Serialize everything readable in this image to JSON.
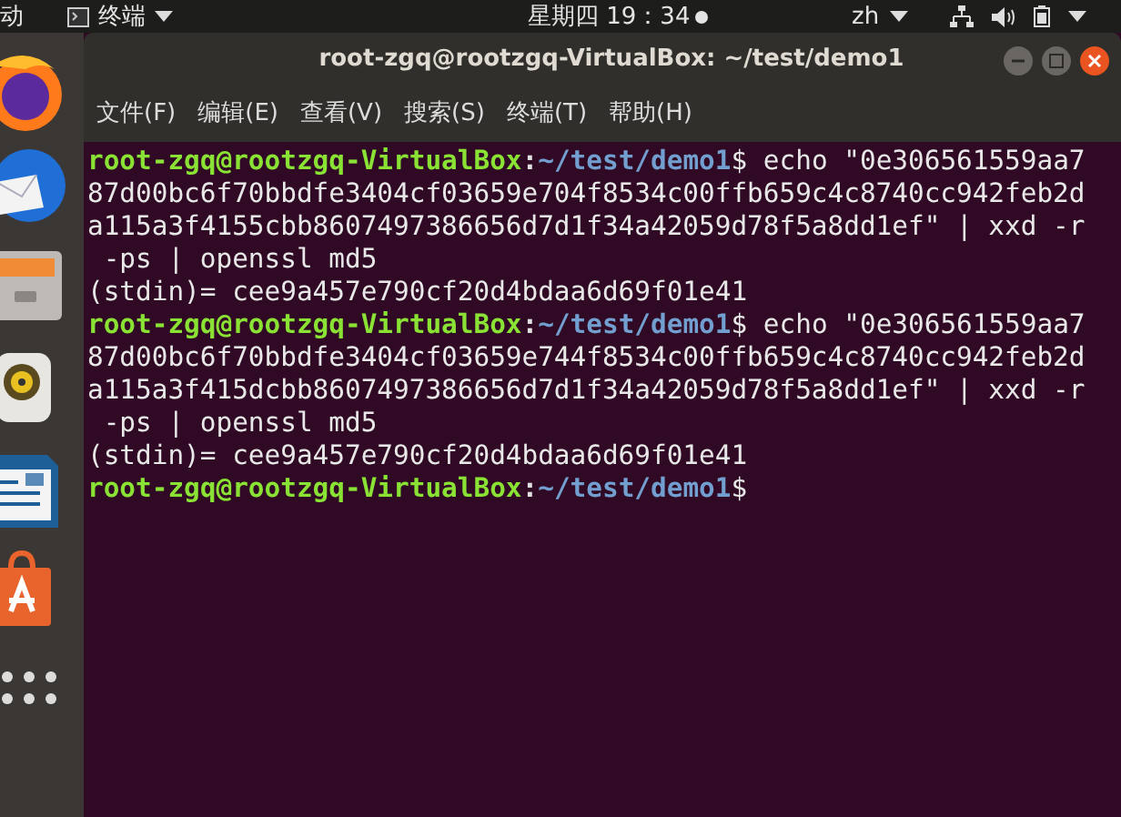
{
  "top_bar": {
    "activities": "动",
    "app_menu": "终端",
    "clock": "星期四 19：34",
    "input_method": "zh"
  },
  "window": {
    "title": "root-zgq@rootzgq-VirtualBox: ~/test/demo1"
  },
  "menu": [
    "文件(F)",
    "编辑(E)",
    "查看(V)",
    "搜索(S)",
    "终端(T)",
    "帮助(H)"
  ],
  "terminal": {
    "lines": [
      {
        "kind": "prompt",
        "user": "root-zgq@rootzgq-VirtualBox",
        "separator": ":",
        "path": "~/test/demo1",
        "command": "$ echo \"0e306561559aa7"
      },
      {
        "kind": "output",
        "text": "87d00bc6f70bbdfe3404cf03659e704f8534c00ffb659c4c8740cc942feb2d"
      },
      {
        "kind": "output",
        "text": "a115a3f4155cbb8607497386656d7d1f34a42059d78f5a8dd1ef\" | xxd -r"
      },
      {
        "kind": "output",
        "text": " -ps | openssl md5"
      },
      {
        "kind": "output",
        "text": "(stdin)= cee9a457e790cf20d4bdaa6d69f01e41"
      },
      {
        "kind": "prompt",
        "user": "root-zgq@rootzgq-VirtualBox",
        "separator": ":",
        "path": "~/test/demo1",
        "command": "$ echo \"0e306561559aa7"
      },
      {
        "kind": "output",
        "text": "87d00bc6f70bbdfe3404cf03659e744f8534c00ffb659c4c8740cc942feb2d"
      },
      {
        "kind": "output",
        "text": "a115a3f415dcbb8607497386656d7d1f34a42059d78f5a8dd1ef\" | xxd -r"
      },
      {
        "kind": "output",
        "text": " -ps | openssl md5"
      },
      {
        "kind": "output",
        "text": "(stdin)= cee9a457e790cf20d4bdaa6d69f01e41"
      },
      {
        "kind": "prompt",
        "user": "root-zgq@rootzgq-VirtualBox",
        "separator": ":",
        "path": "~/test/demo1",
        "command": "$"
      }
    ]
  }
}
